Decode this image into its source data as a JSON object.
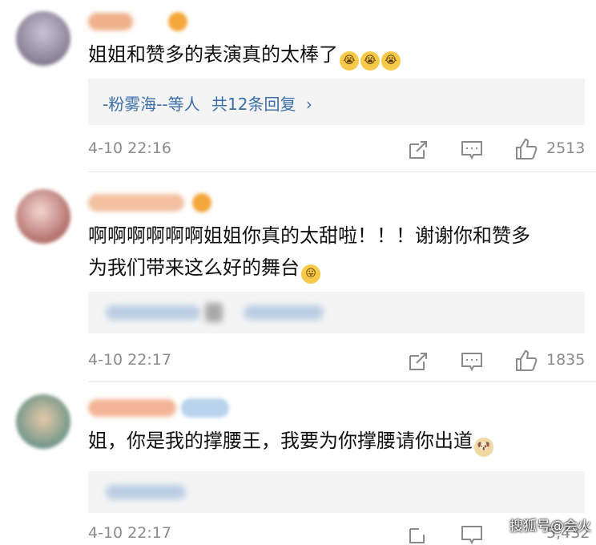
{
  "comments": [
    {
      "text": "姐姐和赞多的表演真的太棒了",
      "emojis": [
        "crying-emoji",
        "crying-emoji",
        "crying-emoji"
      ],
      "reply_prefix": "-粉雾海--等人",
      "reply_count": "共12条回复",
      "reply_chevron": "›",
      "time": "4-10 22:16",
      "likes": "2513"
    },
    {
      "line1": "啊啊啊啊啊啊姐姐你真的太甜啦！！！谢谢你和赞多",
      "line2": "为我们带来这么好的舞台",
      "emojis": [
        "tongue-emoji"
      ],
      "time": "4-10 22:17",
      "likes": "1835"
    },
    {
      "text": "姐，你是我的撑腰王，我要为你撑腰请你出道",
      "emojis": [
        "dog-emoji"
      ],
      "time": "4-10 22:17",
      "likes": "5,432"
    }
  ],
  "colors": {
    "link": "#3a6ea8",
    "meta": "#8a8a8a",
    "reply_bg": "#f4f4f4",
    "badge": "#f4a73b"
  },
  "watermark": "搜狐号@会火"
}
